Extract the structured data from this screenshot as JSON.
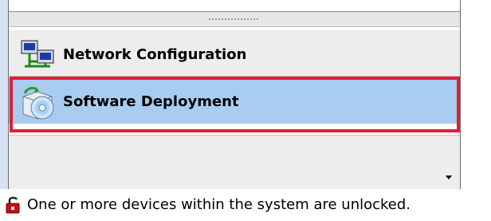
{
  "nav": {
    "items": [
      {
        "label": "Network Configuration",
        "icon": "network-configuration-icon"
      },
      {
        "label": "Software Deployment",
        "icon": "software-deployment-icon",
        "selected": true
      }
    ],
    "overflow_icon": "chevron-down-icon"
  },
  "status": {
    "icon": "unlocked-lock-icon",
    "text": "One or more devices within the system are unlocked."
  },
  "colors": {
    "selected_bg": "#a9cdf1",
    "highlight_border": "#e21d35",
    "button_bg": "#ededed",
    "lock_red": "#c0101a"
  }
}
